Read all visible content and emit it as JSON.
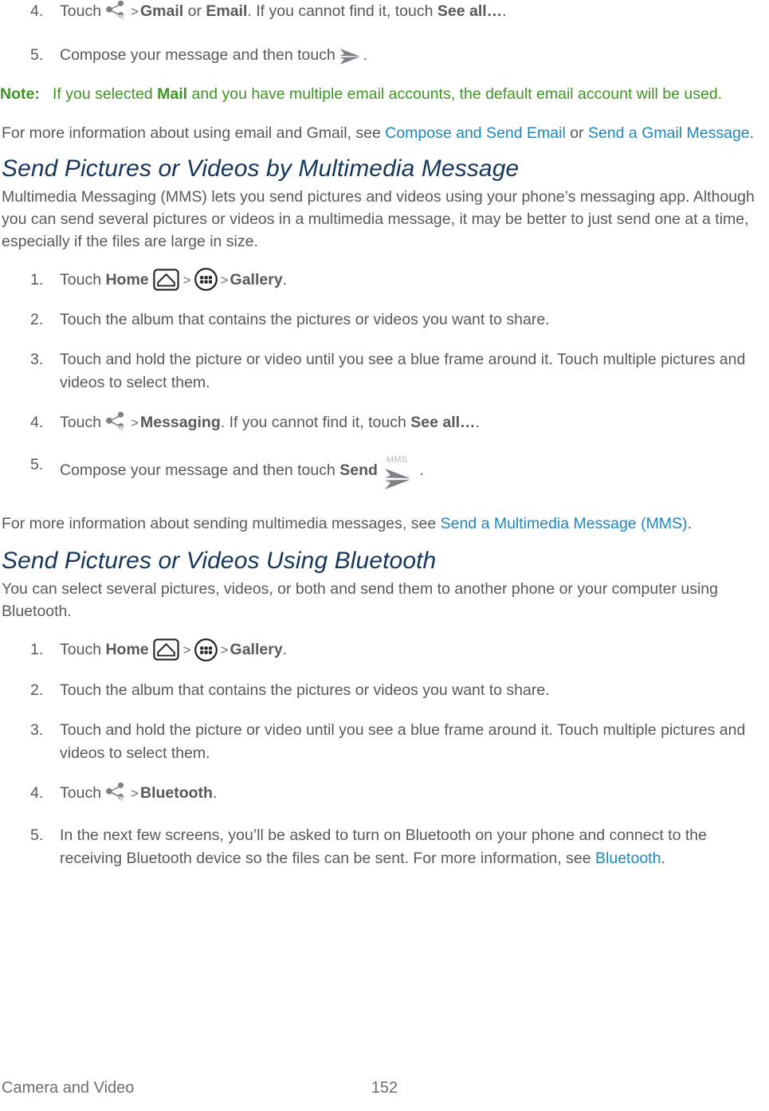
{
  "document": {
    "body_color": "#58595b",
    "heading_color": "#14365e",
    "link_color": "#1b87c0",
    "note_color": "#3f9426"
  },
  "blocks": {
    "step4_email": {
      "num": "4.",
      "pre": "Touch",
      "chevron": ">",
      "bold1": "Gmail",
      "mid": "or",
      "bold2": "Email",
      "after": ". If you cannot find it, touch",
      "bold3": "See all…",
      "end": "."
    },
    "step5_email": {
      "num": "5.",
      "text": "Compose your message and then touch",
      "end": "."
    },
    "note": {
      "label": "Note:",
      "text_before": "If you selected",
      "bold": "Mail",
      "text_after": "and you have multiple email accounts, the default email account will be used."
    },
    "more_info_email": {
      "pre": "For more information about using email and Gmail, see",
      "link1": "Compose and Send Email",
      "mid": "or",
      "link2": "Send a Gmail Message",
      "end": "."
    },
    "mms_section": {
      "heading": "Send Pictures or Videos by Multimedia Message",
      "intro": "Multimedia Messaging (MMS) lets you send pictures and videos using your phone’s messaging app. Although you can send several pictures or videos in a multimedia message, it may be better to just send one at a time, especially if the files are large in size.",
      "steps": {
        "s1": {
          "num": "1.",
          "pre": "Touch",
          "bold_home": "Home",
          "chevron1": ">",
          "chevron2": ">",
          "bold_gallery": "Gallery",
          "end": "."
        },
        "s2": {
          "num": "2.",
          "text": "Touch the album that contains the pictures or videos you want to share."
        },
        "s3": {
          "num": "3.",
          "text": "Touch and hold the picture or video until you see a blue frame around it. Touch multiple pictures and videos to select them."
        },
        "s4": {
          "num": "4.",
          "pre": "Touch",
          "chevron": ">",
          "bold1": "Messaging",
          "after": ". If you cannot find it, touch",
          "bold2": "See all…",
          "end": "."
        },
        "s5": {
          "num": "5.",
          "text": "Compose your message and then touch",
          "bold_send": "Send",
          "end": "."
        }
      },
      "more_info": {
        "pre": "For more information about sending multimedia messages, see",
        "link": "Send a Multimedia Message (MMS)",
        "end": "."
      }
    },
    "bluetooth_section": {
      "heading": "Send Pictures or Videos Using Bluetooth",
      "intro": "You can select several pictures, videos, or both and send them to another phone or your computer using Bluetooth.",
      "steps": {
        "s1": {
          "num": "1.",
          "pre": "Touch",
          "bold_home": "Home",
          "chevron1": ">",
          "chevron2": ">",
          "bold_gallery": "Gallery",
          "end": "."
        },
        "s2": {
          "num": "2.",
          "text": "Touch the album that contains the pictures or videos you want to share."
        },
        "s3": {
          "num": "3.",
          "text": "Touch and hold the picture or video until you see a blue frame around it. Touch multiple pictures and videos to select them."
        },
        "s4": {
          "num": "4.",
          "pre": "Touch",
          "chevron": ">",
          "bold1": "Bluetooth",
          "end": "."
        },
        "s5": {
          "num": "5.",
          "text_before": "In the next few screens, you’ll be asked to turn on Bluetooth on your phone and connect to the receiving Bluetooth device so the files can be sent. For more information, see",
          "link": "Bluetooth",
          "end": "."
        }
      }
    }
  },
  "icons": {
    "share_label": "MMS",
    "mms_label": "MMS"
  },
  "footer": {
    "chapter": "Camera and Video",
    "page_number": "152"
  }
}
